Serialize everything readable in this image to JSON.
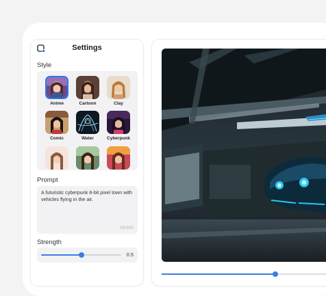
{
  "settings": {
    "title": "Settings",
    "panel_icon": "image-settings-icon"
  },
  "style": {
    "label": "Style",
    "selected": "Anime",
    "options": [
      {
        "label": "Anime"
      },
      {
        "label": "Cartoon"
      },
      {
        "label": "Clay"
      },
      {
        "label": "Comic"
      },
      {
        "label": "Water"
      },
      {
        "label": "Cyberpunk"
      },
      {
        "label": ""
      },
      {
        "label": ""
      },
      {
        "label": ""
      }
    ]
  },
  "prompt": {
    "label": "Prompt",
    "value": "A futuristic cyberpunk 8-bit pixel town with vehicles flying in the air.",
    "char_count": "56/300"
  },
  "strength": {
    "label": "Strength",
    "value": 0.5,
    "value_text": "0.5"
  },
  "preview": {
    "timeline_progress": 0.69
  },
  "colors": {
    "accent": "#3b7de6",
    "selected_border": "#2f76e8"
  }
}
